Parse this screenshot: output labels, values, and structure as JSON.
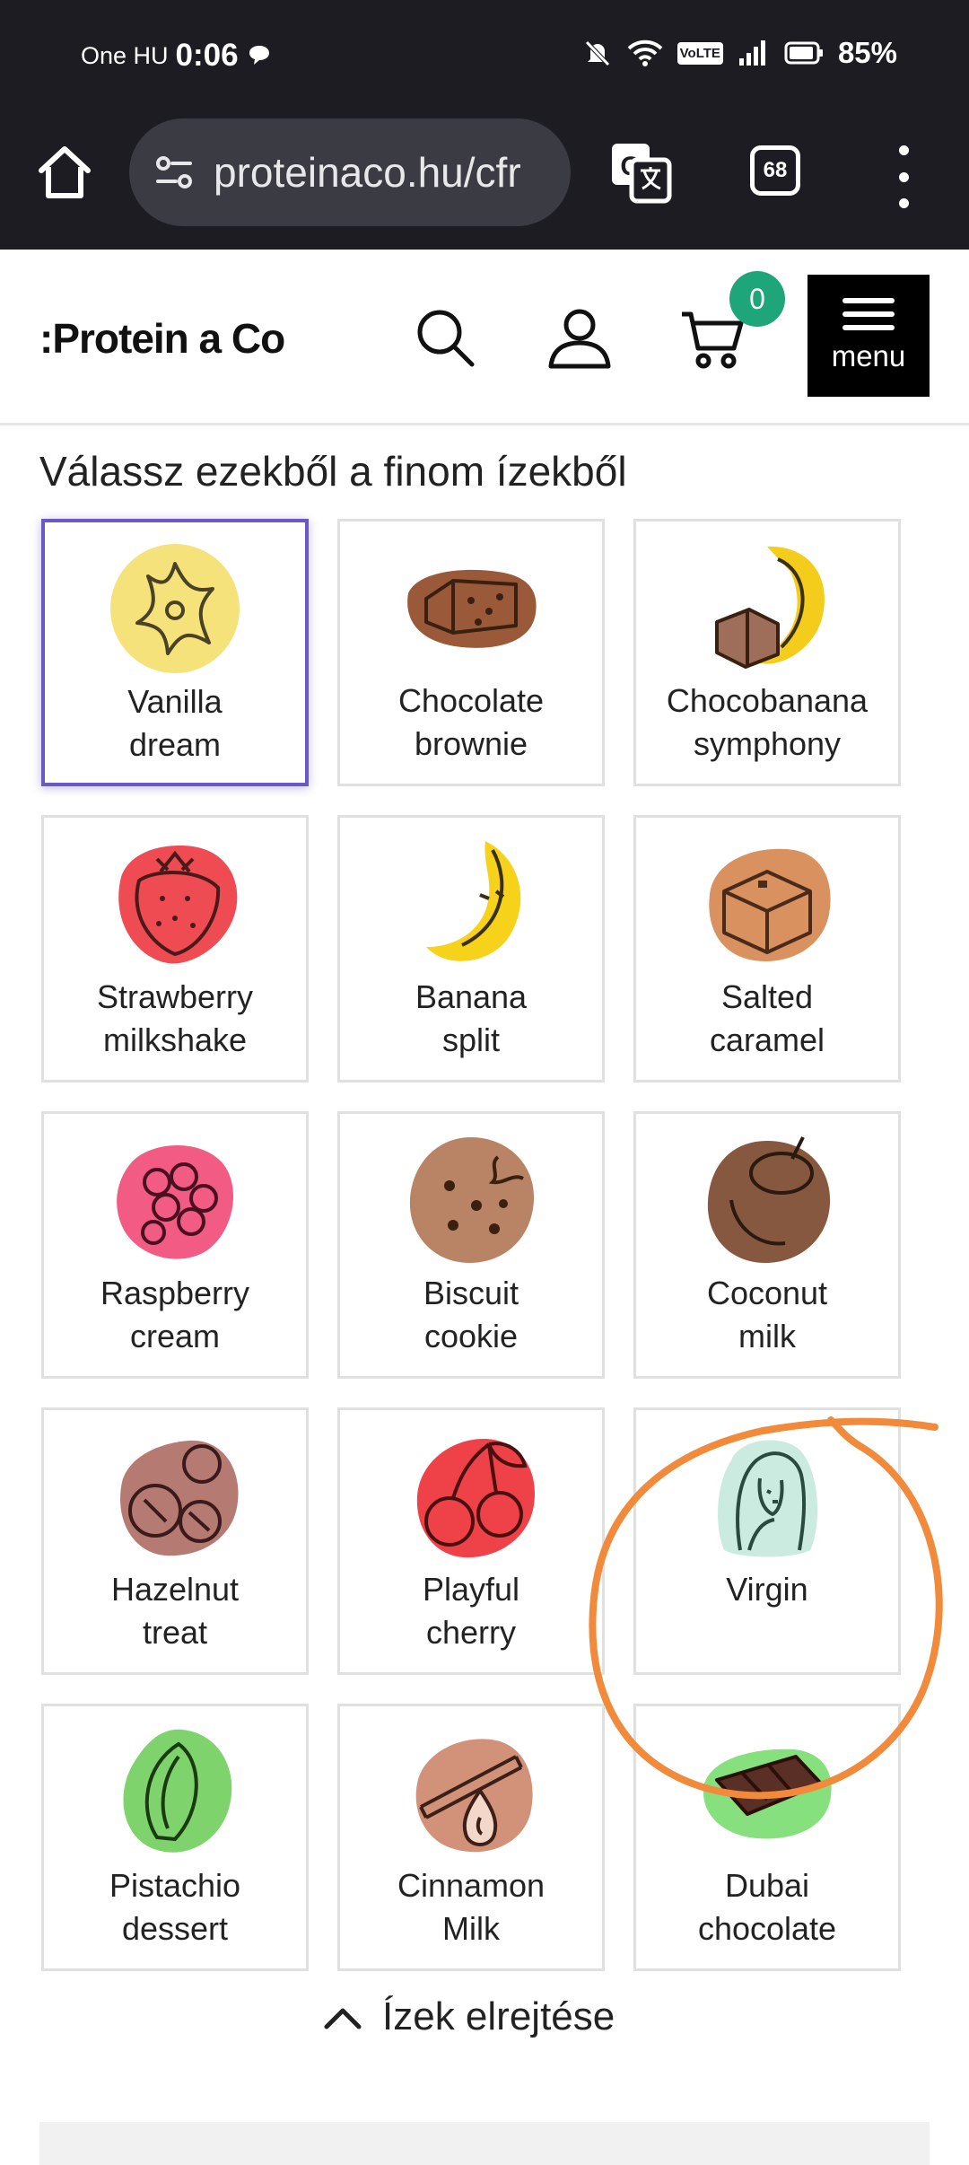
{
  "status_bar": {
    "carrier": "One HU",
    "time": "0:06",
    "network_badge": "VoLTE",
    "battery": "85%"
  },
  "browser": {
    "url": "proteinaco.hu/cfr",
    "tab_count": "68"
  },
  "site": {
    "logo": ":Protein a Co",
    "cart_count": "0",
    "menu_label": "menu"
  },
  "flavors": {
    "title": "Válassz ezekből a finom ízekből",
    "items": [
      {
        "label": "Vanilla\ndream",
        "icon": "vanilla-flower-icon",
        "color": "#f6e27a",
        "selected": true
      },
      {
        "label": "Chocolate\nbrownie",
        "icon": "brownie-icon",
        "color": "#9a5a3a"
      },
      {
        "label": "Chocobanana\nsymphony",
        "icon": "chocobanana-icon",
        "color": "#f4cc1c"
      },
      {
        "label": "Strawberry\nmilkshake",
        "icon": "strawberry-icon",
        "color": "#ef4b52"
      },
      {
        "label": "Banana\nsplit",
        "icon": "banana-icon",
        "color": "#f7d21b"
      },
      {
        "label": "Salted\ncaramel",
        "icon": "caramel-icon",
        "color": "#d9915f"
      },
      {
        "label": "Raspberry\ncream",
        "icon": "raspberry-icon",
        "color": "#f25c84"
      },
      {
        "label": "Biscuit\ncookie",
        "icon": "cookie-icon",
        "color": "#b98365"
      },
      {
        "label": "Coconut\nmilk",
        "icon": "coconut-icon",
        "color": "#86583f"
      },
      {
        "label": "Hazelnut\ntreat",
        "icon": "hazelnut-icon",
        "color": "#b57a72"
      },
      {
        "label": "Playful\ncherry",
        "icon": "cherry-icon",
        "color": "#ef4148"
      },
      {
        "label": "Virgin",
        "icon": "virgin-figure-icon",
        "color": "#ccebe0"
      },
      {
        "label": "Pistachio\ndessert",
        "icon": "pistachio-icon",
        "color": "#7ed36c"
      },
      {
        "label": "Cinnamon\nMilk",
        "icon": "cinnamon-icon",
        "color": "#d2927a"
      },
      {
        "label": "Dubai\nchocolate",
        "icon": "dubai-chocolate-icon",
        "color": "#86e07e"
      }
    ]
  },
  "hide_flavors_label": "Ízek elrejtése",
  "annotation_color": "#f28a3c"
}
